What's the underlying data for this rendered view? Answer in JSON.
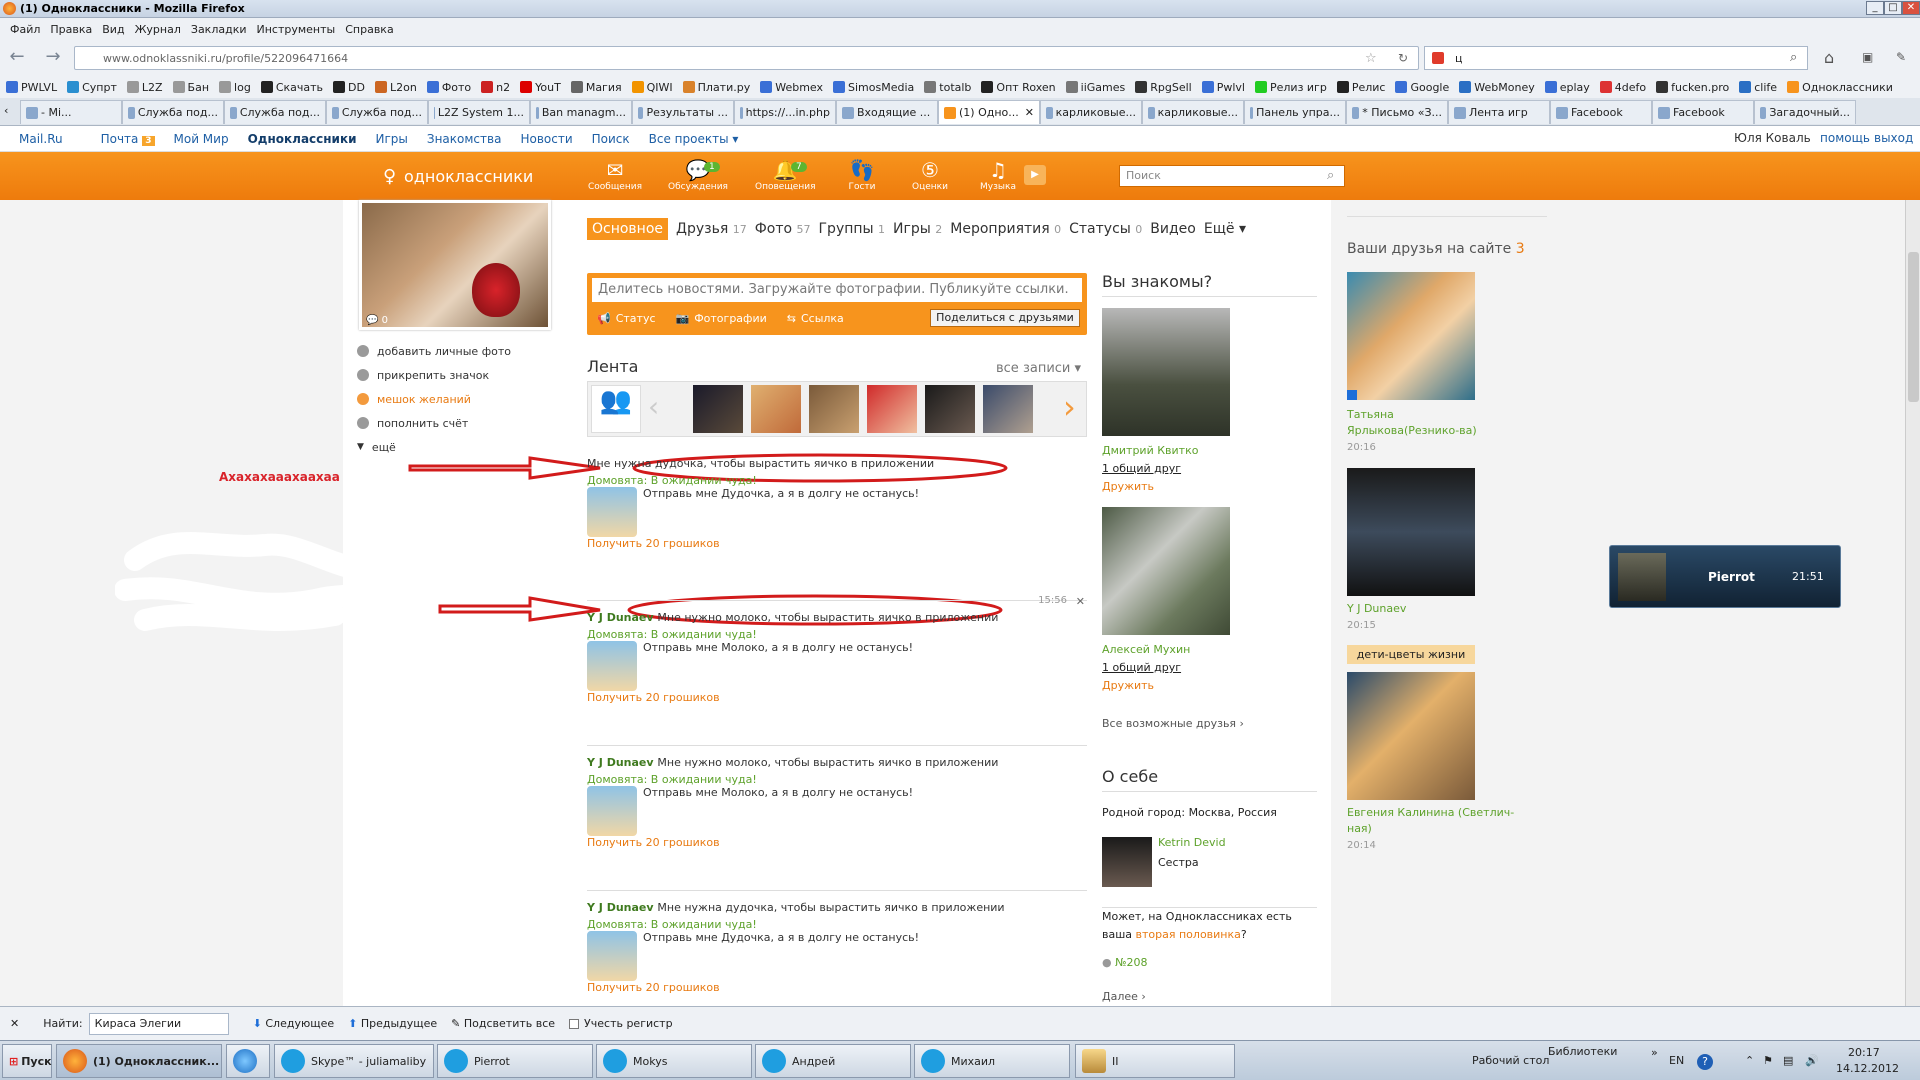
{
  "window": {
    "title": "(1) Одноклассники - Mozilla Firefox",
    "minimize": "_",
    "maximize": "□",
    "close": "✕"
  },
  "menu": [
    "Файл",
    "Правка",
    "Вид",
    "Журнал",
    "Закладки",
    "Инструменты",
    "Справка"
  ],
  "nav": {
    "url": "www.odnoklassniki.ru/profile/522096471664",
    "search_value": "ц"
  },
  "bookmarks": [
    "PWLVL",
    "Супрт",
    "L2Z",
    "Бан",
    "log",
    "Скачать",
    "DD",
    "L2on",
    "Фото",
    "n2",
    "YouT",
    "Магия",
    "QIWI",
    "Плати.ру",
    "Webmex",
    "SimosMedia",
    "totalb",
    "Опт Roxen",
    "iiGames",
    "RpgSell",
    "Pwlvl",
    "Релиз игр",
    "Релис",
    "Google",
    "WebMoney",
    "eplay",
    "4defo",
    "fucken.pro",
    "clife",
    "Одноклассники"
  ],
  "tabs": [
    "- Mi...",
    "Служба под...",
    "Служба под...",
    "Служба под...",
    "L2Z System 1...",
    "Ban managm...",
    "Результаты ...",
    "https://...in.php",
    "Входящие ...",
    "(1) Одно...",
    "карликовые...",
    "карликовые...",
    "Панель упра...",
    "* Письмо «З...",
    "Лента игр",
    "Facebook",
    "Facebook",
    "Загадочный..."
  ],
  "mailru": {
    "items": [
      "Mail.Ru",
      "Почта",
      "Мой Мир",
      "Одноклассники",
      "Игры",
      "Знакомства",
      "Новости",
      "Поиск",
      "Все проекты ▾"
    ],
    "mail_count": "3",
    "user": "Юля Коваль",
    "help": "помощь",
    "logout": "выход"
  },
  "ok": {
    "logo": "одноклассники",
    "search_placeholder": "Поиск",
    "icons": [
      {
        "label": "Сообщения",
        "badge": ""
      },
      {
        "label": "Обсуждения",
        "badge": "1"
      },
      {
        "label": "Оповещения",
        "badge": "7"
      },
      {
        "label": "Гости",
        "badge": ""
      },
      {
        "label": "Оценки",
        "badge": ""
      },
      {
        "label": "Музыка",
        "badge": ""
      }
    ]
  },
  "left": {
    "photo_comments": "0",
    "links": [
      "добавить личные фото",
      "прикрепить значок",
      "мешок желаний",
      "пополнить счёт",
      "ещё"
    ],
    "annotation": "Ахахахааахаахаа"
  },
  "profile_tabs": [
    {
      "label": "Основное",
      "count": ""
    },
    {
      "label": "Друзья",
      "count": "17"
    },
    {
      "label": "Фото",
      "count": "57"
    },
    {
      "label": "Группы",
      "count": "1"
    },
    {
      "label": "Игры",
      "count": "2"
    },
    {
      "label": "Мероприятия",
      "count": "0"
    },
    {
      "label": "Статусы",
      "count": "0"
    },
    {
      "label": "Видео",
      "count": ""
    },
    {
      "label": "Ещё ▾",
      "count": ""
    }
  ],
  "post": {
    "placeholder": "Делитесь новостями. Загружайте фотографии. Публикуйте ссылки.",
    "status": "Статус",
    "photos": "Фотографии",
    "link": "Ссылка",
    "share": "Поделиться с друзьями"
  },
  "feed": {
    "title": "Лента",
    "all": "все записи ▾",
    "items": [
      {
        "who": "",
        "text": "Мне нужна дудочка, чтобы вырастить яичко в приложении",
        "state": "Домовята: В ожидании чуда!",
        "msg": "Отправь мне Дудочка, а я в долгу не останусь!",
        "get": "Получить 20 грошиков",
        "time": ""
      },
      {
        "who": "Y J Dunaev",
        "text": "Мне нужно молоко, чтобы вырастить яичко в приложении",
        "state": "Домовята: В ожидании чуда!",
        "msg": "Отправь мне Молоко, а я в долгу не останусь!",
        "get": "Получить 20 грошиков",
        "time": "15:56"
      },
      {
        "who": "Y J Dunaev",
        "text": "Мне нужно молоко, чтобы вырастить яичко в приложении",
        "state": "Домовята: В ожидании чуда!",
        "msg": "Отправь мне Молоко, а я в долгу не останусь!",
        "get": "Получить 20 грошиков",
        "time": ""
      },
      {
        "who": "Y J Dunaev",
        "text": "Мне нужна дудочка, чтобы вырастить яичко в приложении",
        "state": "Домовята: В ожидании чуда!",
        "msg": "Отправь мне Дудочка, а я в долгу не останусь!",
        "get": "Получить 20 грошиков",
        "time": ""
      }
    ]
  },
  "know": {
    "title": "Вы знакомы?",
    "people": [
      {
        "name": "Дмитрий Квитко",
        "common": "1 общий друг",
        "add": "Дружить"
      },
      {
        "name": "Алексей Мухин",
        "common": "1 общий друг",
        "add": "Дружить"
      }
    ],
    "all": "Все возможные друзья ›"
  },
  "about": {
    "title": "О себе",
    "city": "Родной город: Москва, Россия",
    "relative_name": "Ketrin Devid",
    "relative_role": "Сестра",
    "q1": "Может, на Одноклассниках есть ваша ",
    "q_link": "вторая половинка",
    "q2": "?",
    "num": "№208",
    "more": "Далее ›"
  },
  "friends": {
    "title": "Ваши друзья на сайте",
    "count": "3",
    "people": [
      {
        "name": "Татьяна Ярлыкова(Резнико-ва)",
        "time": "20:16",
        "tag": ""
      },
      {
        "name": "Y J Dunaev",
        "time": "20:15",
        "tag": ""
      },
      {
        "name": "Евгения Калинина (Светлич-ная)",
        "time": "20:14",
        "tag": "дети-цветы жизни"
      }
    ]
  },
  "popup": {
    "name": "Pierrot",
    "time": "21:51"
  },
  "findbar": {
    "close": "✕",
    "label": "Найти:",
    "value": "Кираса Элегии",
    "next": "Следующее",
    "prev": "Предыдущее",
    "highlight": "Подсветить все",
    "match_case": "Учесть регистр"
  },
  "taskbar": {
    "start": "Пуск",
    "tasks": [
      "(1) Одноклассник...",
      "",
      "Skype™ - juliamaliby",
      "Pierrot",
      "Mokys",
      "Андрей",
      "Михаил",
      "II"
    ],
    "desktop": "Рабочий стол",
    "libraries": "Библиотеки",
    "lang": "EN",
    "time": "20:17",
    "date": "14.12.2012"
  }
}
